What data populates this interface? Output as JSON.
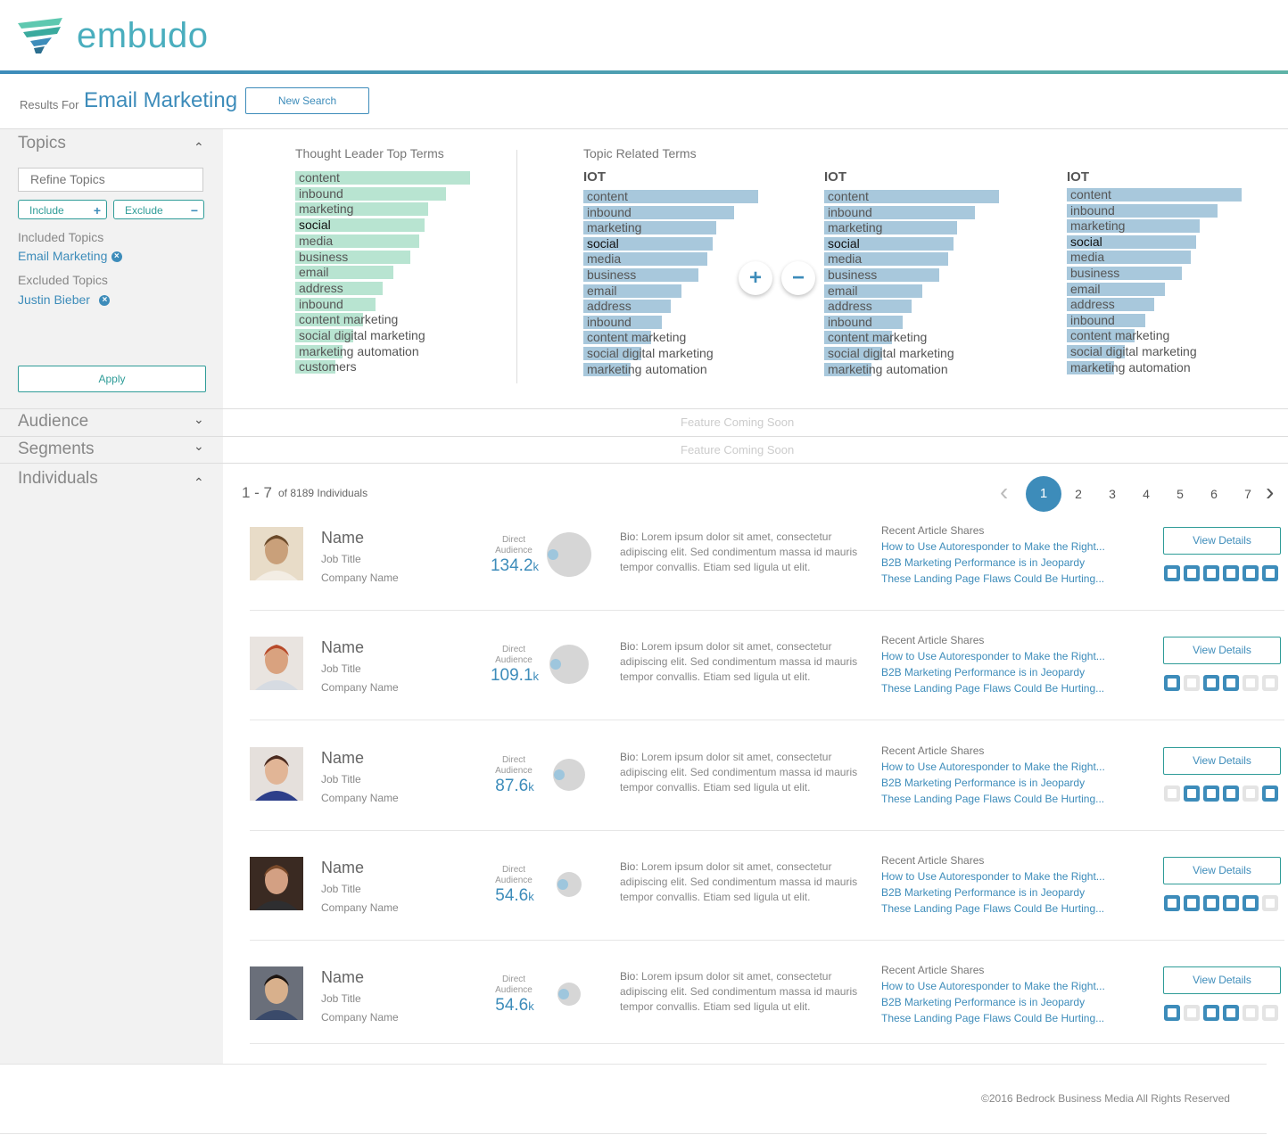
{
  "brand": "embudo",
  "results": {
    "label": "Results For",
    "query": "Email Marketing",
    "new_search": "New Search"
  },
  "sidebar": {
    "topics": "Topics",
    "refine_placeholder": "Refine Topics",
    "include": "Include",
    "include_sym": "+",
    "exclude": "Exclude",
    "exclude_sym": "−",
    "included_label": "Included Topics",
    "included_item": "Email Marketing",
    "excluded_label": "Excluded Topics",
    "excluded_item": "Justin Bieber",
    "remove_sym": "×",
    "apply": "Apply",
    "audience": "Audience",
    "segments": "Segments",
    "individuals": "Individuals",
    "chev_up": "⌃",
    "chev_down": "⌄"
  },
  "topics_panel": {
    "thought_leader_label": "Thought Leader  Top Terms",
    "related_label": "Topic Related Terms",
    "thought_leader_terms": [
      {
        "term": "content",
        "value": 100
      },
      {
        "term": "inbound",
        "value": 86
      },
      {
        "term": "marketing",
        "value": 76
      },
      {
        "term": "social",
        "value": 74,
        "highlight": true
      },
      {
        "term": "media",
        "value": 71
      },
      {
        "term": "business",
        "value": 66
      },
      {
        "term": "email",
        "value": 56
      },
      {
        "term": "address",
        "value": 50
      },
      {
        "term": "inbound",
        "value": 46
      },
      {
        "term": "content marketing",
        "value": 39
      },
      {
        "term": "social digital marketing",
        "value": 33
      },
      {
        "term": "marketing automation",
        "value": 27
      },
      {
        "term": "customers",
        "value": 23
      }
    ],
    "related_groups": [
      {
        "title": "IOT",
        "terms": [
          {
            "term": "content",
            "value": 100
          },
          {
            "term": "inbound",
            "value": 86
          },
          {
            "term": "marketing",
            "value": 76
          },
          {
            "term": "social",
            "value": 74,
            "highlight": true
          },
          {
            "term": "media",
            "value": 71
          },
          {
            "term": "business",
            "value": 66
          },
          {
            "term": "email",
            "value": 56
          },
          {
            "term": "address",
            "value": 50
          },
          {
            "term": "inbound",
            "value": 45
          },
          {
            "term": "content marketing",
            "value": 39
          },
          {
            "term": "social digital marketing",
            "value": 33
          },
          {
            "term": "marketing automation",
            "value": 27
          }
        ]
      },
      {
        "title": "IOT",
        "terms": [
          {
            "term": "content",
            "value": 100
          },
          {
            "term": "inbound",
            "value": 86
          },
          {
            "term": "marketing",
            "value": 76
          },
          {
            "term": "social",
            "value": 74,
            "highlight": true
          },
          {
            "term": "media",
            "value": 71
          },
          {
            "term": "business",
            "value": 66
          },
          {
            "term": "email",
            "value": 56
          },
          {
            "term": "address",
            "value": 50
          },
          {
            "term": "inbound",
            "value": 45
          },
          {
            "term": "content marketing",
            "value": 39
          },
          {
            "term": "social digital marketing",
            "value": 33
          },
          {
            "term": "marketing automation",
            "value": 27
          }
        ]
      },
      {
        "title": "IOT",
        "terms": [
          {
            "term": "content",
            "value": 100
          },
          {
            "term": "inbound",
            "value": 86
          },
          {
            "term": "marketing",
            "value": 76
          },
          {
            "term": "social",
            "value": 74,
            "highlight": true
          },
          {
            "term": "media",
            "value": 71
          },
          {
            "term": "business",
            "value": 66
          },
          {
            "term": "email",
            "value": 56
          },
          {
            "term": "address",
            "value": 50
          },
          {
            "term": "inbound",
            "value": 45
          },
          {
            "term": "content marketing",
            "value": 39
          },
          {
            "term": "social digital marketing",
            "value": 33
          },
          {
            "term": "marketing automation",
            "value": 27
          }
        ]
      }
    ],
    "add_sym": "+",
    "remove_sym": "−",
    "colors": {
      "thought_leader_bar": "#b8e4d1",
      "related_bar": "#a8c8dc"
    }
  },
  "coming_soon": "Feature Coming Soon",
  "individuals": {
    "range": "1 - 7",
    "count_text": "of 8189 Individuals",
    "pages": [
      "1",
      "2",
      "3",
      "4",
      "5",
      "6",
      "7"
    ],
    "prev": "‹",
    "next": "›",
    "audience_label": "Direct Audience",
    "bio_label": "Bio:",
    "bio_text": " Lorem ipsum dolor sit amet, consectetur adipiscing elit. Sed condimentum massa id mauris tempor convallis. Etiam sed ligula ut elit.",
    "shares_title": "Recent Article Shares",
    "share_links": [
      "How to Use Autoresponder to Make the Right...",
      "B2B Marketing Performance is in Jeopardy",
      "These Landing Page Flaws Could Be Hurting..."
    ],
    "view_details": "View Details",
    "people": [
      {
        "name": "Name",
        "job": "Job Title",
        "company": "Company Name",
        "audience_num": "134.2",
        "audience_unit": "k",
        "socials": [
          true,
          true,
          true,
          true,
          true,
          true
        ]
      },
      {
        "name": "Name",
        "job": "Job Title",
        "company": "Company Name",
        "audience_num": "109.1",
        "audience_unit": "k",
        "socials": [
          true,
          false,
          true,
          true,
          false,
          false
        ]
      },
      {
        "name": "Name",
        "job": "Job Title",
        "company": "Company Name",
        "audience_num": "87.6",
        "audience_unit": "k",
        "socials": [
          false,
          true,
          true,
          true,
          false,
          true
        ]
      },
      {
        "name": "Name",
        "job": "Job Title",
        "company": "Company Name",
        "audience_num": "54.6",
        "audience_unit": "k",
        "socials": [
          true,
          true,
          true,
          true,
          true,
          false
        ]
      },
      {
        "name": "Name",
        "job": "Job Title",
        "company": "Company Name",
        "audience_num": "54.6",
        "audience_unit": "k",
        "socials": [
          true,
          false,
          true,
          true,
          false,
          false
        ]
      }
    ],
    "social_icons": [
      "phone-icon",
      "email-icon",
      "linkedin-icon",
      "twitter-icon",
      "facebook-icon",
      "pinterest-icon"
    ]
  },
  "footer": "©2016 Bedrock Business Media All Rights Reserved"
}
